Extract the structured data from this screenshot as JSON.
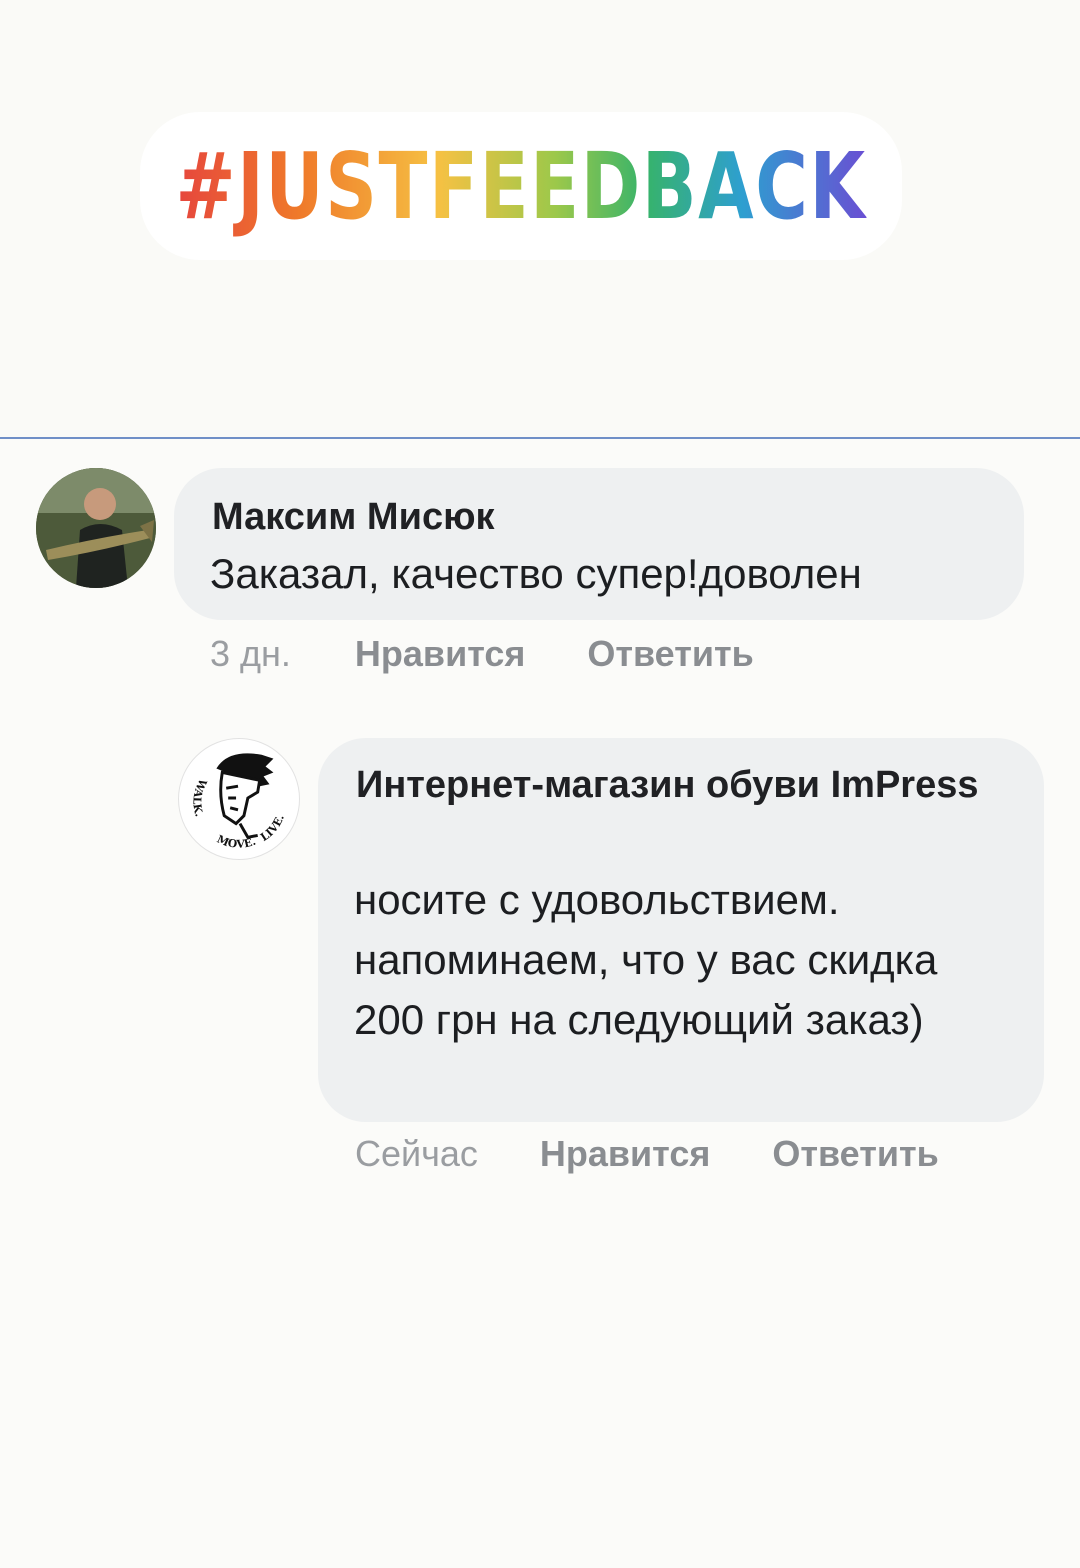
{
  "story": {
    "hashtag": "#JUSTFEEDBACK"
  },
  "comments": [
    {
      "author": "Максим Мисюк",
      "text": "Заказал, качество  супер!доволен",
      "time": "3 дн.",
      "like_label": "Нравится",
      "reply_label": "Ответить",
      "avatar_icon": "user-photo-avatar"
    },
    {
      "author": "Интернет-магазин обуви ImPress",
      "text": "носите с удовольствием. напоминаем, что у вас скидка 200 грн на следующий заказ)",
      "time": "Сейчас",
      "like_label": "Нравится",
      "reply_label": "Ответить",
      "avatar_icon": "brand-logo-avatar",
      "avatar_logo_text": "WALK. MOVE. LIVE."
    }
  ],
  "colors": {
    "bubble": "#eef0f1",
    "divider": "#6f8fc7",
    "meta_text": "#8a8d91",
    "background": "#fbfbf9"
  }
}
